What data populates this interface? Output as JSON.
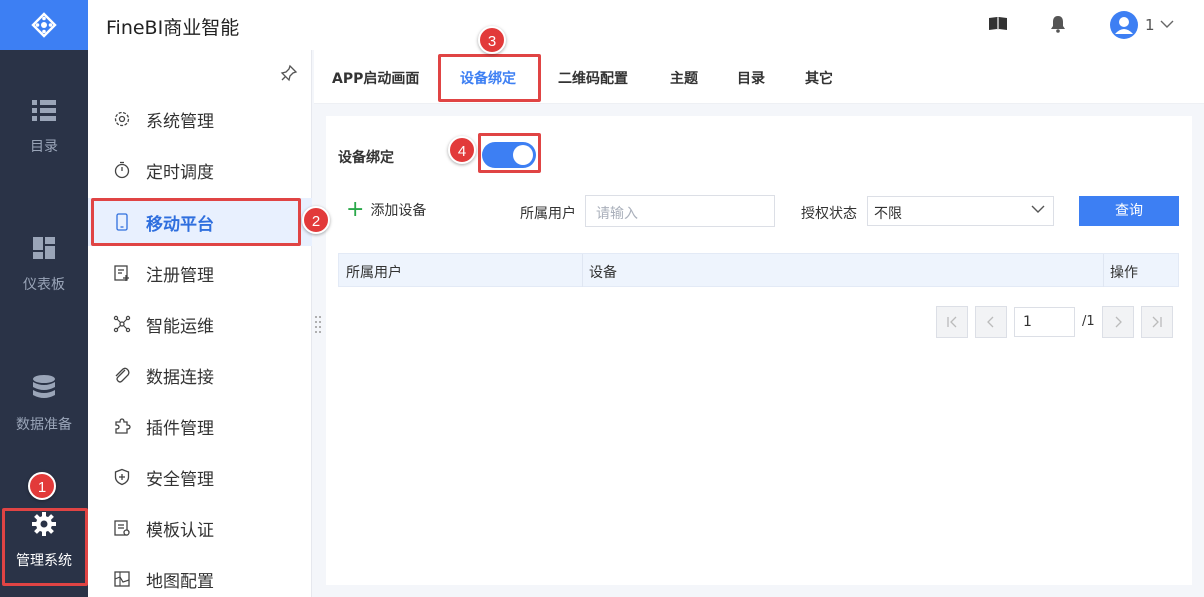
{
  "app": {
    "title": "FineBI商业智能",
    "user": "1"
  },
  "rail": {
    "items": [
      {
        "label": "目录",
        "icon": "list-icon"
      },
      {
        "label": "仪表板",
        "icon": "dashboard-icon"
      },
      {
        "label": "数据准备",
        "icon": "database-icon"
      },
      {
        "label": "管理系统",
        "icon": "gear-icon"
      }
    ]
  },
  "sidebar": {
    "items": [
      {
        "label": "系统管理",
        "icon": "settings-icon"
      },
      {
        "label": "定时调度",
        "icon": "timer-icon"
      },
      {
        "label": "移动平台",
        "icon": "mobile-icon"
      },
      {
        "label": "注册管理",
        "icon": "register-icon"
      },
      {
        "label": "智能运维",
        "icon": "network-icon"
      },
      {
        "label": "数据连接",
        "icon": "paperclip-icon"
      },
      {
        "label": "插件管理",
        "icon": "puzzle-icon"
      },
      {
        "label": "安全管理",
        "icon": "shield-icon"
      },
      {
        "label": "模板认证",
        "icon": "template-icon"
      },
      {
        "label": "地图配置",
        "icon": "map-icon"
      }
    ]
  },
  "tabs": [
    {
      "label": "APP启动画面"
    },
    {
      "label": "设备绑定"
    },
    {
      "label": "二维码配置"
    },
    {
      "label": "主题"
    },
    {
      "label": "目录"
    },
    {
      "label": "其它"
    }
  ],
  "content": {
    "device_binding_label": "设备绑定",
    "toggle_on": true,
    "add_device": "添加设备",
    "user_label": "所属用户",
    "user_placeholder": "请输入",
    "auth_label": "授权状态",
    "auth_value": "不限",
    "query_button": "查询",
    "table_headers": [
      "所属用户",
      "设备",
      "操作"
    ],
    "page_current": "1",
    "page_total": "/1"
  },
  "annotations": [
    "1",
    "2",
    "3",
    "4"
  ],
  "colors": {
    "accent": "#3d7ff3",
    "rail": "#2a3347",
    "highlight": "#e04444"
  }
}
